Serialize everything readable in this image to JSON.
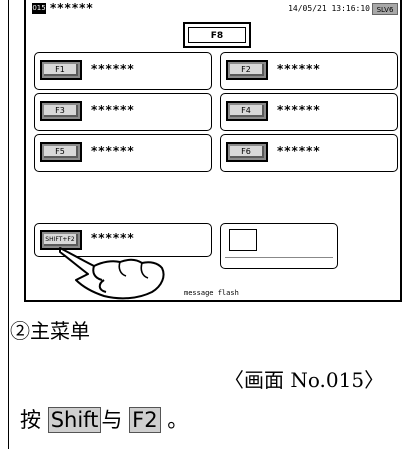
{
  "screen": {
    "screen_no": "015",
    "title": "******",
    "datetime": "14/05/21 13:16:10",
    "level": "SLV6",
    "f8_label": "F8",
    "message": "message flash"
  },
  "function_keys": [
    {
      "label": "F1",
      "text": "******"
    },
    {
      "label": "F2",
      "text": "******"
    },
    {
      "label": "F3",
      "text": "******"
    },
    {
      "label": "F4",
      "text": "******"
    },
    {
      "label": "F5",
      "text": "******"
    },
    {
      "label": "F6",
      "text": "******"
    }
  ],
  "shift_key": {
    "label": "SHIFT+F2",
    "text": "******"
  },
  "caption": "②主菜单",
  "screen_ref": "〈画面 No.015〉",
  "instruction": {
    "prefix": "按",
    "key1": "Shift",
    "middle": "与",
    "key2": "F2",
    "suffix": "。"
  },
  "icons": {
    "hand": "pointing-hand-icon"
  }
}
